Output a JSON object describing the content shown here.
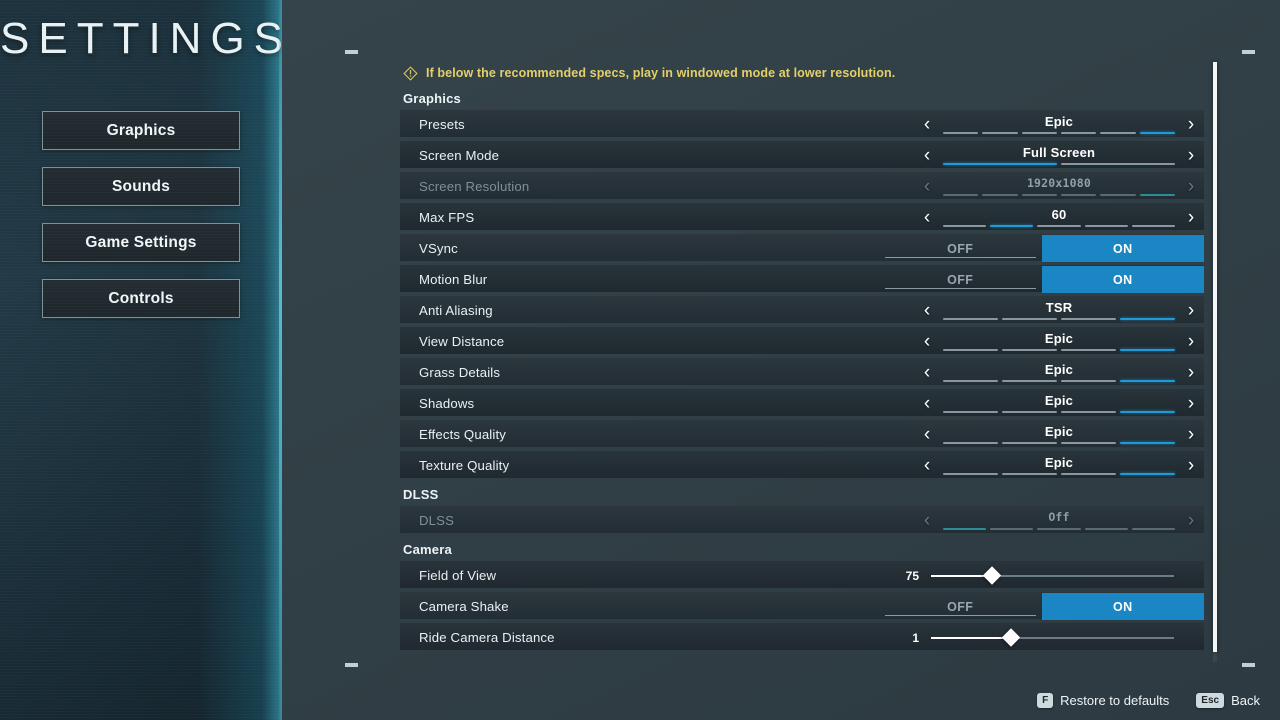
{
  "title": "SETTINGS",
  "sidebar": {
    "items": [
      {
        "label": "Graphics"
      },
      {
        "label": "Sounds"
      },
      {
        "label": "Game Settings"
      },
      {
        "label": "Controls"
      }
    ]
  },
  "warning": {
    "icon": "warning-diamond-icon",
    "text": "If below the recommended specs, play in windowed mode at lower resolution."
  },
  "sections": [
    {
      "header": "Graphics",
      "rows": [
        {
          "label": "Presets",
          "type": "stepper",
          "value": "Epic",
          "segments": 6,
          "active": 6,
          "disabled": false
        },
        {
          "label": "Screen Mode",
          "type": "stepper",
          "value": "Full Screen",
          "segments": 2,
          "active": 1,
          "disabled": false
        },
        {
          "label": "Screen Resolution",
          "type": "stepper",
          "value": "1920x1080",
          "segments": 6,
          "active": 6,
          "disabled": true
        },
        {
          "label": "Max FPS",
          "type": "stepper",
          "value": "60",
          "segments": 5,
          "active": 2,
          "disabled": false
        },
        {
          "label": "VSync",
          "type": "toggle",
          "off_label": "OFF",
          "on_label": "ON",
          "value": "ON"
        },
        {
          "label": "Motion Blur",
          "type": "toggle",
          "off_label": "OFF",
          "on_label": "ON",
          "value": "ON"
        },
        {
          "label": "Anti Aliasing",
          "type": "stepper",
          "value": "TSR",
          "segments": 4,
          "active": 4,
          "disabled": false
        },
        {
          "label": "View Distance",
          "type": "stepper",
          "value": "Epic",
          "segments": 4,
          "active": 4,
          "disabled": false
        },
        {
          "label": "Grass Details",
          "type": "stepper",
          "value": "Epic",
          "segments": 4,
          "active": 4,
          "disabled": false
        },
        {
          "label": "Shadows",
          "type": "stepper",
          "value": "Epic",
          "segments": 4,
          "active": 4,
          "disabled": false
        },
        {
          "label": "Effects Quality",
          "type": "stepper",
          "value": "Epic",
          "segments": 4,
          "active": 4,
          "disabled": false
        },
        {
          "label": "Texture Quality",
          "type": "stepper",
          "value": "Epic",
          "segments": 4,
          "active": 4,
          "disabled": false
        }
      ]
    },
    {
      "header": "DLSS",
      "rows": [
        {
          "label": "DLSS",
          "type": "stepper",
          "value": "Off",
          "segments": 5,
          "active": 1,
          "disabled": true
        }
      ]
    },
    {
      "header": "Camera",
      "rows": [
        {
          "label": "Field of View",
          "type": "slider",
          "value": "75",
          "percent": 25
        },
        {
          "label": "Camera Shake",
          "type": "toggle",
          "off_label": "OFF",
          "on_label": "ON",
          "value": "ON"
        },
        {
          "label": "Ride Camera Distance",
          "type": "slider",
          "value": "1",
          "percent": 33
        }
      ]
    }
  ],
  "footer": {
    "restore_key": "F",
    "restore_label": "Restore to defaults",
    "back_key": "Esc",
    "back_label": "Back"
  },
  "colors": {
    "accent_blue": "#1a86c4",
    "segment_on": "#1f9ad6",
    "warning_yellow": "#e3cf6a",
    "teal_line": "#5abede"
  }
}
